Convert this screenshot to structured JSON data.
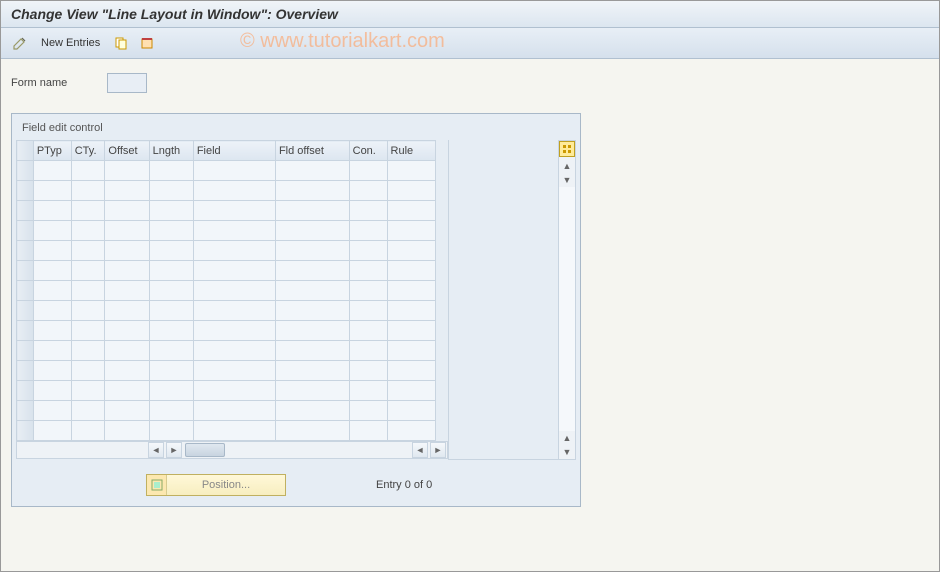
{
  "title": "Change View \"Line Layout in Window\": Overview",
  "toolbar": {
    "new_entries_label": "New Entries"
  },
  "watermark": "© www.tutorialkart.com",
  "form": {
    "name_label": "Form name",
    "name_value": ""
  },
  "panel": {
    "title": "Field edit control",
    "columns": [
      "PTyp",
      "CTy.",
      "Offset",
      "Lngth",
      "Field",
      "Fld offset",
      "Con.",
      "Rule"
    ],
    "row_count": 14
  },
  "footer": {
    "position_label": "Position...",
    "entry_text": "Entry 0 of 0"
  }
}
